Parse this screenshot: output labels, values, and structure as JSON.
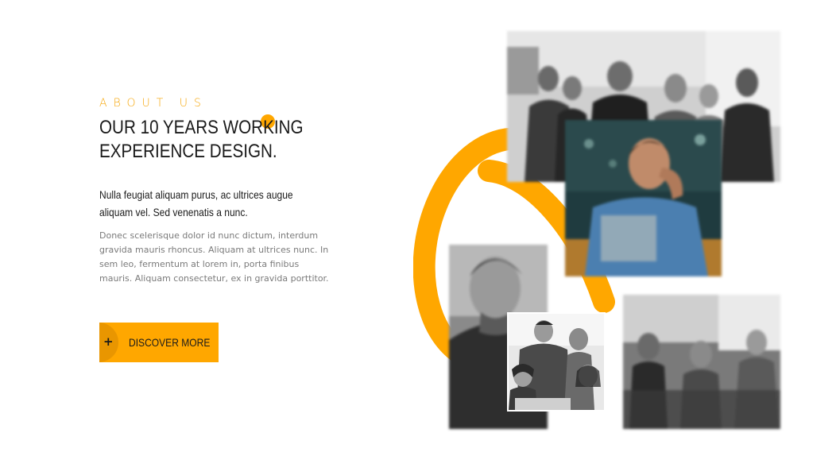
{
  "about": {
    "eyebrow": "ABOUT US",
    "title": "OUR 10 YEARS WORKING EXPERIENCE DESIGN.",
    "lead": "Nulla feugiat aliquam purus, ac ultrices augue aliquam vel. Sed venenatis a nunc.",
    "body": "Donec scelerisque dolor id nunc dictum, interdum gravida mauris rhoncus. Aliquam at ultrices nunc. In sem leo, fermentum at lorem in, porta finibus mauris. Aliquam consectetur, ex in gravida porttitor.",
    "button": {
      "icon_text": "+",
      "label": "DISCOVER MORE"
    }
  },
  "icons": {
    "button_icon": "plus-icon"
  },
  "colors": {
    "accent": "#ffa700",
    "accent_dark": "#e99600",
    "text_dark": "#1a1a1a",
    "text_muted": "#7a7a7a"
  }
}
